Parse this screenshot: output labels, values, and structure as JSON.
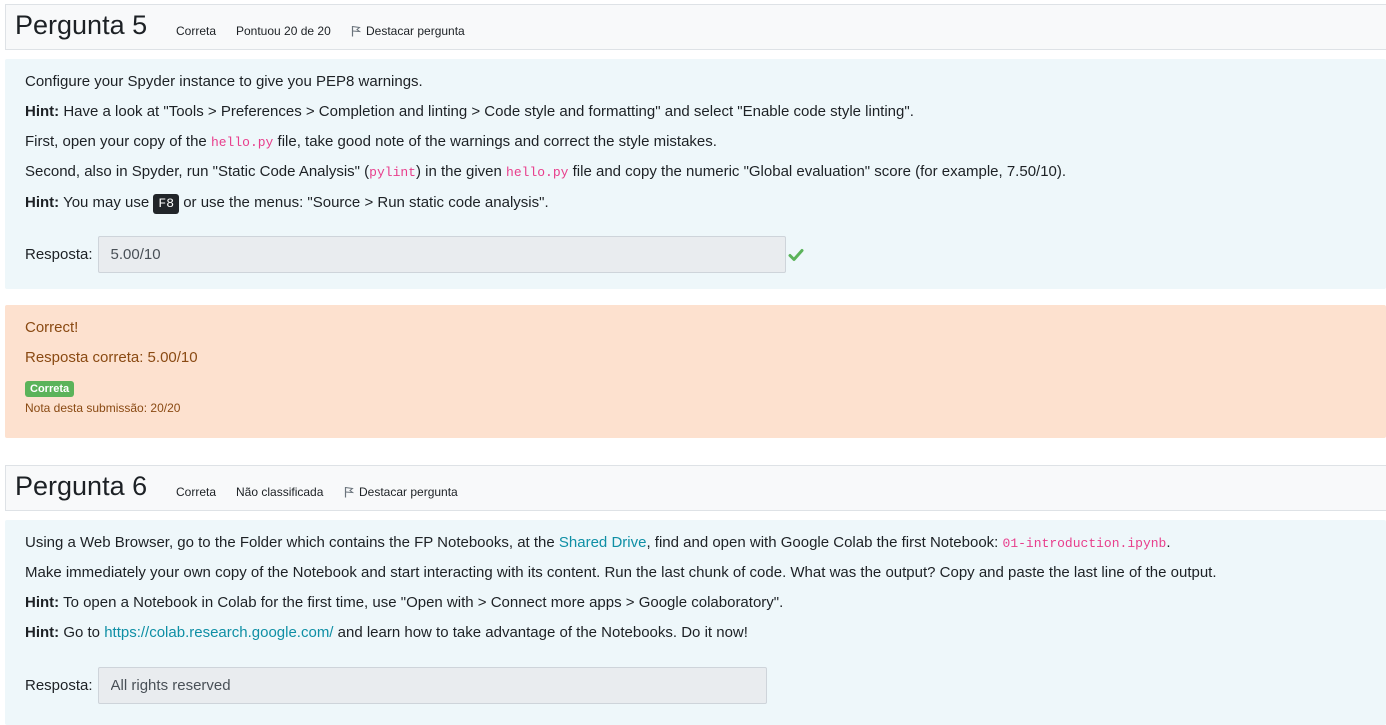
{
  "q5": {
    "title": "Pergunta 5",
    "status": "Correta",
    "score": "Pontuou 20 de 20",
    "flag_label": "Destacar pergunta",
    "intro": "Configure your Spyder instance to give you PEP8 warnings.",
    "hint_label": "Hint:",
    "hint1": "Have a look at \"Tools > Preferences > Completion and linting > Code style and formatting\" and select \"Enable code style linting\".",
    "first_a": "First, open your copy of the",
    "first_code": "hello.py",
    "first_b": "file, take good note of the warnings and correct the style mistakes.",
    "second_a": "Second, also in Spyder, run \"Static Code Analysis\" (",
    "second_code1": "pylint",
    "second_b": ") in the given",
    "second_code2": "hello.py",
    "second_c": "file and copy the numeric \"Global evaluation\" score (for example, 7.50/10).",
    "hint2_a": "You may use",
    "hint2_key": "F8",
    "hint2_b": "or use the menus: \"Source > Run static code analysis\".",
    "answer_label": "Resposta:",
    "answer_value": "5.00/10",
    "check_icon": "check-icon"
  },
  "feedback": {
    "correct": "Correct!",
    "right_answer": "Resposta correta: 5.00/10",
    "badge": "Correta",
    "grade": "Nota desta submissão: 20/20",
    "color": "#8a4a13",
    "bg": "#fde1cf"
  },
  "q6": {
    "title": "Pergunta 6",
    "status": "Correta",
    "score": "Não classificada",
    "flag_label": "Destacar pergunta",
    "p1_a": "Using a Web Browser, go to the Folder which contains the FP Notebooks, at the",
    "p1_link": "Shared Drive",
    "p1_b": ", find and open with Google Colab the first Notebook:",
    "p1_code": "01-introduction.ipynb",
    "p1_c": ".",
    "p2": "Make immediately your own copy of the Notebook and start interacting with its content. Run the last chunk of code. What was the output? Copy and paste the last line of the output.",
    "hint_label": "Hint:",
    "hint1": "To open a Notebook in Colab for the first time, use \"Open with > Connect more apps > Google colaboratory\".",
    "hint2_a": "Go to",
    "hint2_link": "https://colab.research.google.com/",
    "hint2_b": "and learn how to take advantage of the Notebooks. Do it now!",
    "answer_label": "Resposta:",
    "answer_value": "All rights reserved"
  }
}
